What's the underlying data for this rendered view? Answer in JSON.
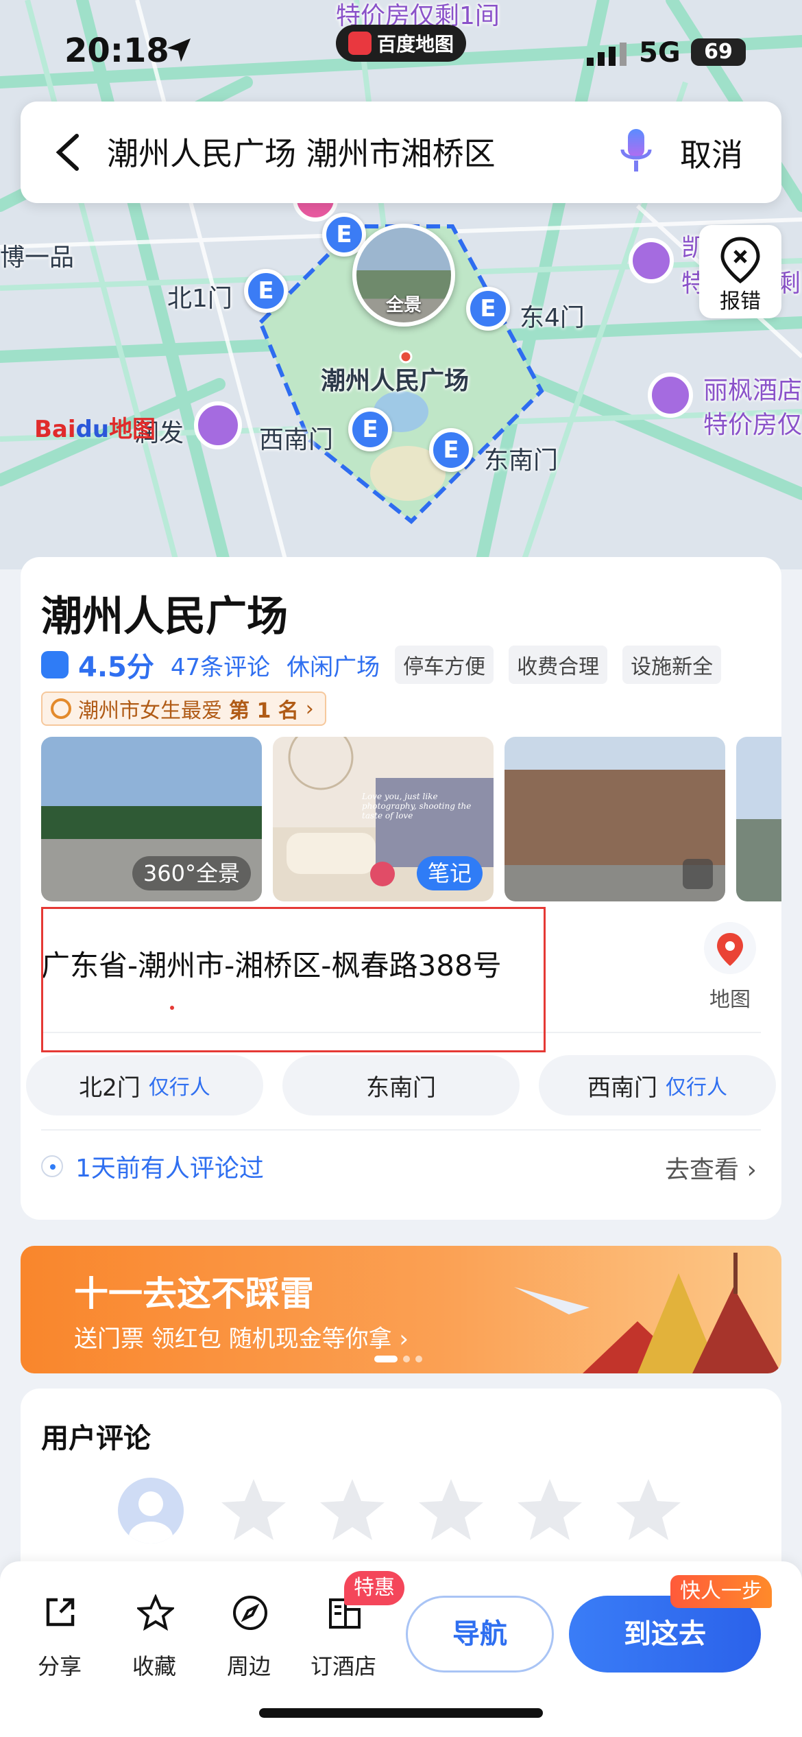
{
  "status_bar": {
    "time": "20:18",
    "network": "5G",
    "battery": "69",
    "app_pill": "百度地图"
  },
  "search": {
    "query": "潮州人民广场 潮州市湘桥区",
    "cancel_label": "取消"
  },
  "map": {
    "report_label": "报错",
    "panorama_label": "全景",
    "logo_text": "Bai",
    "logo_du": "du",
    "logo_suffix": "地图",
    "labels": {
      "top_promo": "特价房仅剩1间",
      "park_name": "潮州人民广场",
      "gate_north1": "北1门",
      "gate_east4": "东4门",
      "gate_southwest": "西南门",
      "gate_southeast": "东南门",
      "poi_left_top": "博一品",
      "poi_left_bottom": "润发",
      "hotel_right_1": "凯",
      "hotel_right_1b": "特",
      "hotel_right_1c": "剩",
      "hotel_right_2": "丽枫酒店",
      "hotel_right_2_promo": "特价房仅"
    }
  },
  "poi": {
    "title": "潮州人民广场",
    "rating": "4.5分",
    "review_count": "47条评论",
    "category": "休闲广场",
    "tags": [
      "停车方便",
      "收费合理",
      "设施新全"
    ],
    "rank_text": "潮州市女生最爱",
    "rank_value": "第 1 名",
    "rank_chevron": "›",
    "photos": {
      "panorama_badge": "360°全景",
      "note_badge": "笔记",
      "note_caption": "Love you, just like photography, shooting the taste of love"
    },
    "address": "广东省-潮州市-湘桥区-枫春路388号",
    "map_button_label": "地图",
    "gates": [
      {
        "name": "北2门",
        "note": "仅行人"
      },
      {
        "name": "东南门",
        "note": ""
      },
      {
        "name": "西南门",
        "note": "仅行人"
      }
    ],
    "recent_review": "1天前有人评论过",
    "go_check": "去查看 ›"
  },
  "promo": {
    "title": "十一去这不踩雷",
    "subtitle": "送门票 领红包 随机现金等你拿 ›"
  },
  "reviews": {
    "title": "用户评论",
    "star_count": 5
  },
  "bottom_bar": {
    "share": "分享",
    "favorite": "收藏",
    "nearby": "周边",
    "hotel": "订酒店",
    "hotel_badge": "特惠",
    "navigate": "导航",
    "go_here": "到这去",
    "quick_badge": "快人一步"
  },
  "colors": {
    "accent": "#2f6ff0",
    "promo_orange": "#f9862c",
    "annotation_red": "#e53935"
  }
}
